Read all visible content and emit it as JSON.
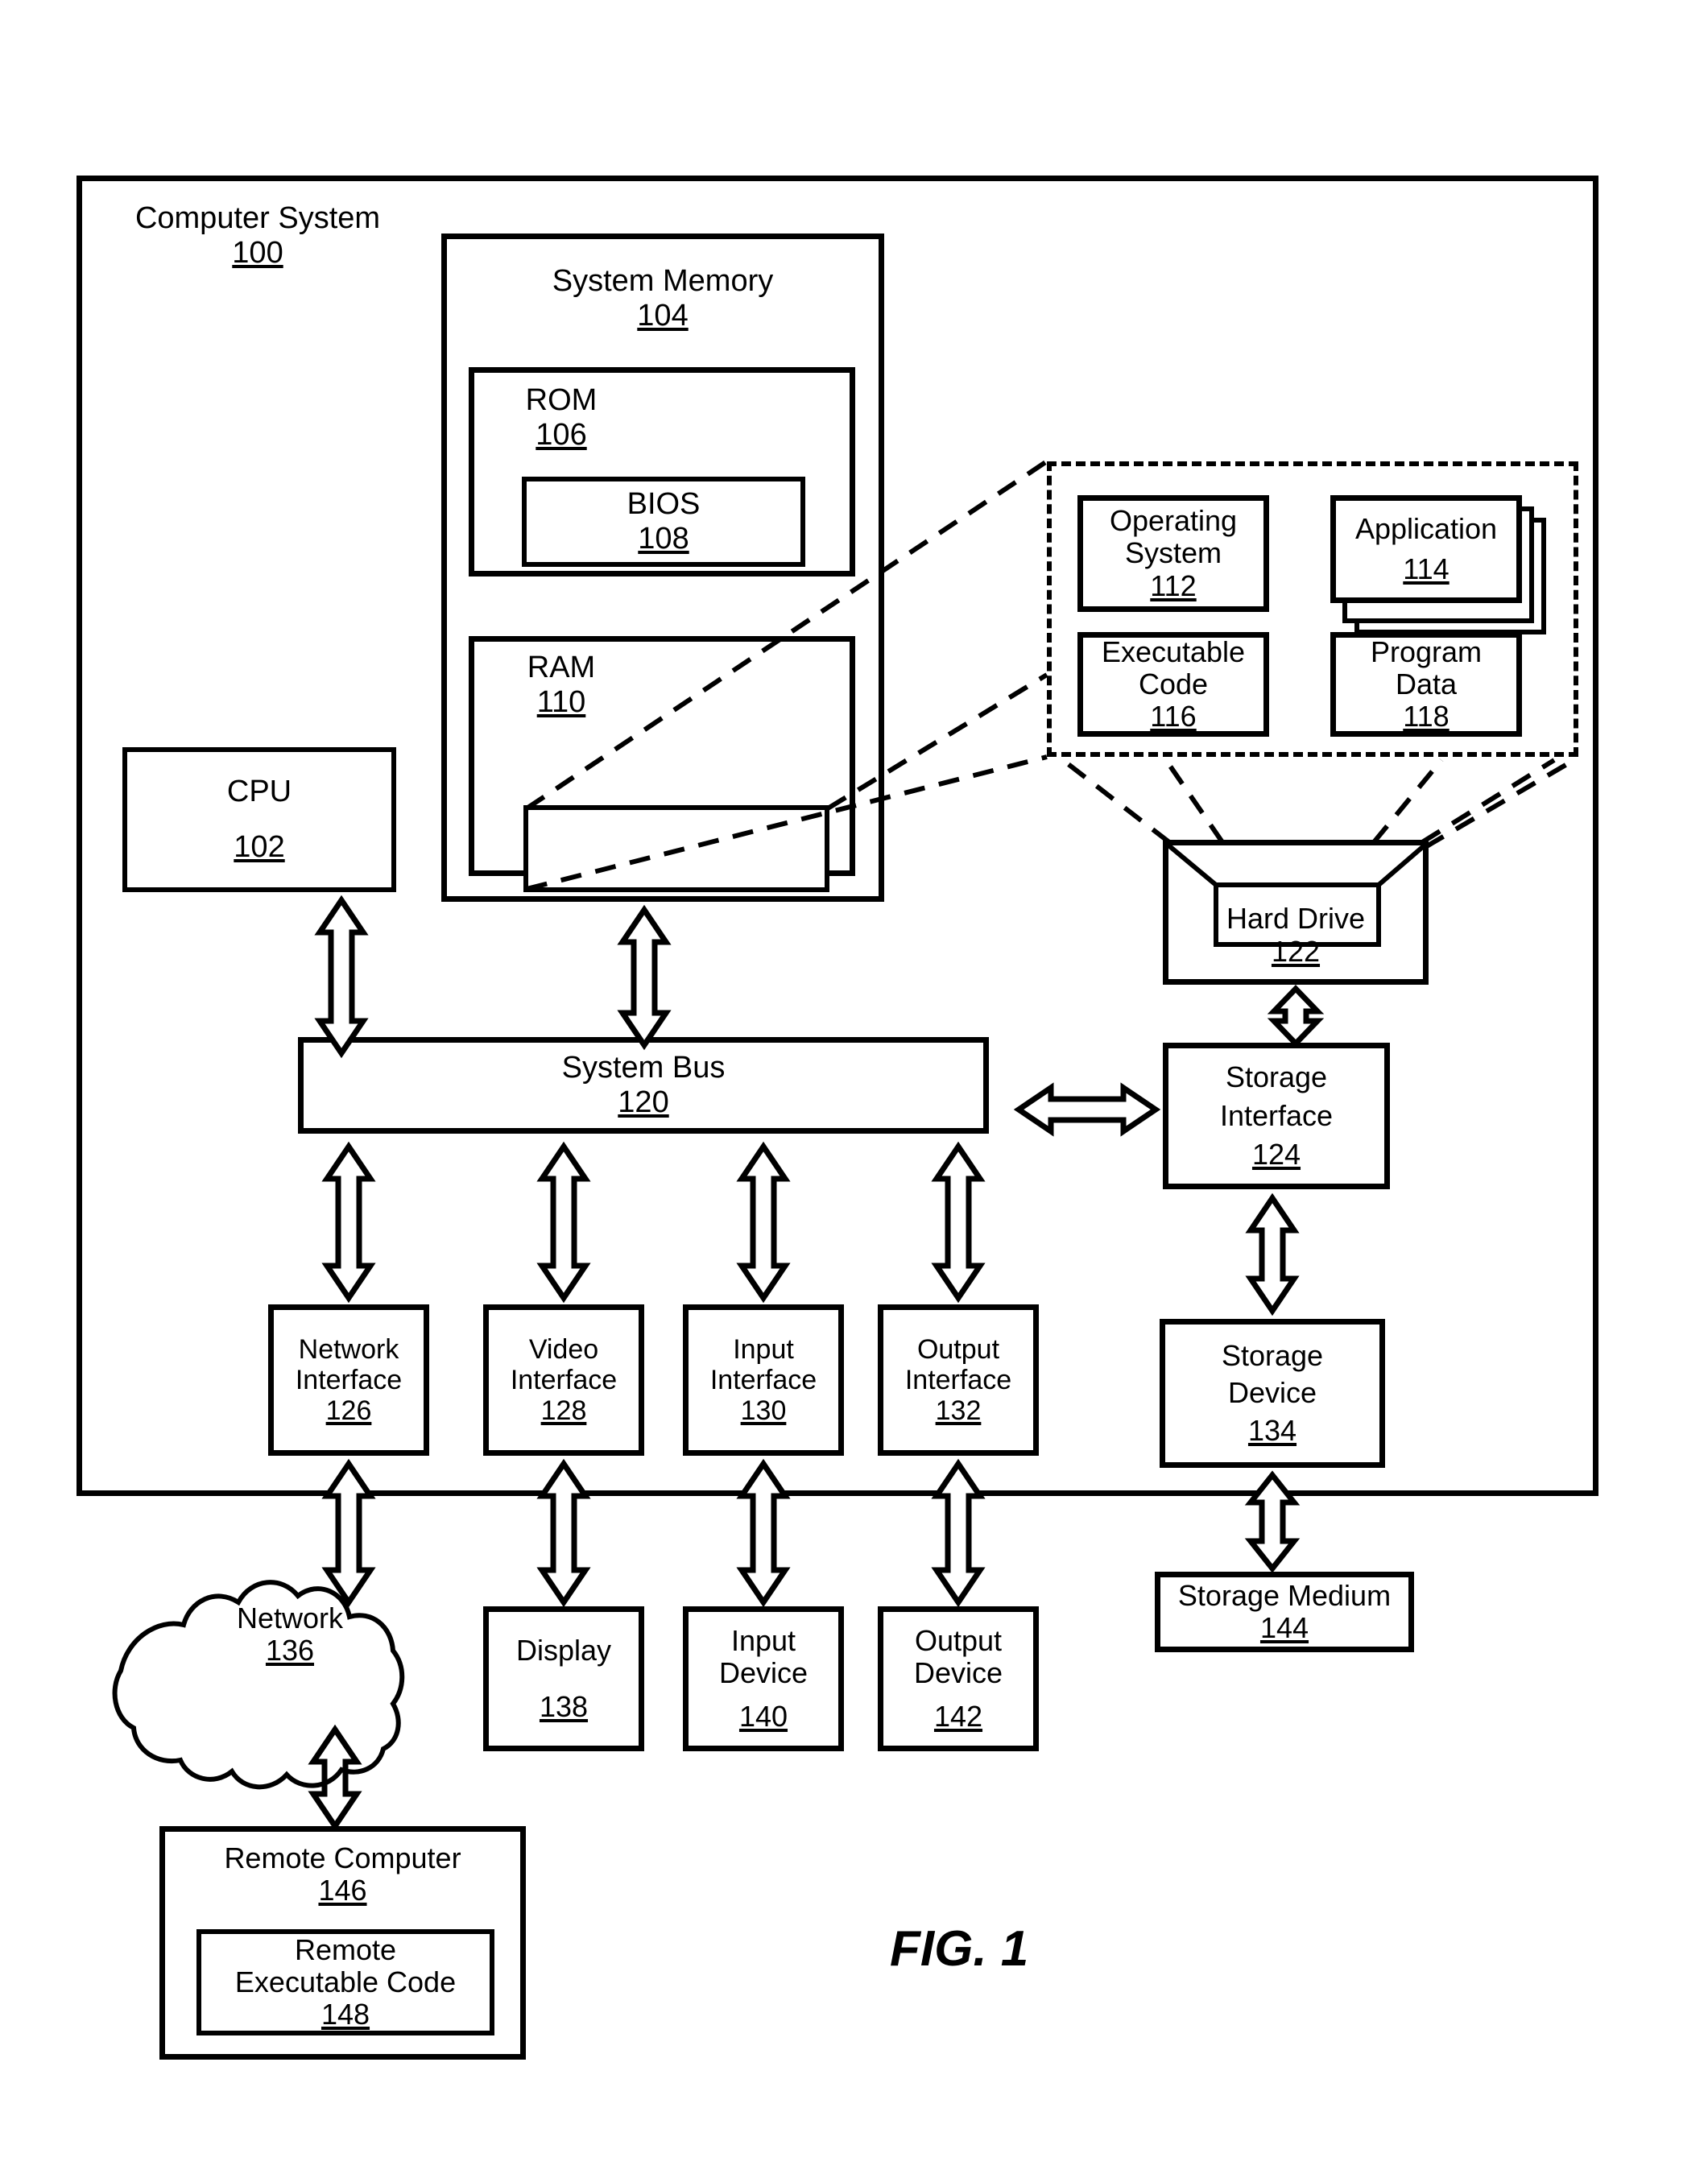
{
  "figure": {
    "caption": "FIG. 1",
    "title": "Computer System",
    "title_number": "100"
  },
  "system_memory": {
    "label": "System Memory",
    "number": "104"
  },
  "rom": {
    "label": "ROM",
    "number": "106"
  },
  "bios": {
    "label": "BIOS",
    "number": "108"
  },
  "ram": {
    "label": "RAM",
    "number": "110"
  },
  "cpu": {
    "label": "CPU",
    "number": "102"
  },
  "callout": {
    "operating_system": {
      "line1": "Operating",
      "line2": "System",
      "number": "112"
    },
    "application": {
      "line1": "Application",
      "number": "114"
    },
    "executable_code": {
      "line1": "Executable",
      "line2": "Code",
      "number": "116"
    },
    "program_data": {
      "line1": "Program",
      "line2": "Data",
      "number": "118"
    }
  },
  "hard_drive": {
    "label": "Hard Drive",
    "number": "122"
  },
  "system_bus": {
    "label": "System Bus",
    "number": "120"
  },
  "storage_interface": {
    "line1": "Storage",
    "line2": "Interface",
    "number": "124"
  },
  "interfaces": [
    {
      "line1": "Network",
      "line2": "Interface",
      "number": "126"
    },
    {
      "line1": "Video",
      "line2": "Interface",
      "number": "128"
    },
    {
      "line1": "Input",
      "line2": "Interface",
      "number": "130"
    },
    {
      "line1": "Output",
      "line2": "Interface",
      "number": "132"
    }
  ],
  "storage_device": {
    "line1": "Storage",
    "line2": "Device",
    "number": "134"
  },
  "network": {
    "label": "Network",
    "number": "136"
  },
  "peripherals": [
    {
      "line1": "Display",
      "line2": "",
      "number": "138"
    },
    {
      "line1": "Input",
      "line2": "Device",
      "number": "140"
    },
    {
      "line1": "Output",
      "line2": "Device",
      "number": "142"
    }
  ],
  "storage_medium": {
    "label": "Storage Medium",
    "number": "144"
  },
  "remote_computer": {
    "label": "Remote Computer",
    "number": "146"
  },
  "remote_executable_code": {
    "line1": "Remote",
    "line2": "Executable Code",
    "number": "148"
  },
  "style": {
    "stroke": "#000000",
    "background": "#ffffff"
  }
}
